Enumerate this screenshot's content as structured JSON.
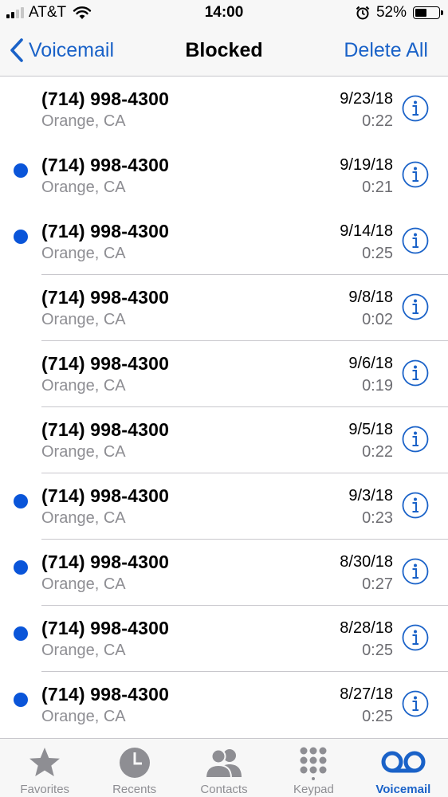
{
  "status": {
    "carrier": "AT&T",
    "time": "14:00",
    "battery_percent": "52%",
    "battery_level": 0.52,
    "icons": [
      "signal-icon",
      "wifi-icon",
      "alarm-icon",
      "battery-icon"
    ]
  },
  "nav": {
    "back_label": "Voicemail",
    "title": "Blocked",
    "action_label": "Delete All"
  },
  "colors": {
    "accent": "#1a62c8",
    "unread_dot": "#0a55d9",
    "secondary_text": "#8e8e93"
  },
  "voicemails": [
    {
      "number": "(714) 998-4300",
      "location": "Orange, CA",
      "date": "9/23/18",
      "duration": "0:22",
      "unread": false
    },
    {
      "number": "(714) 998-4300",
      "location": "Orange, CA",
      "date": "9/19/18",
      "duration": "0:21",
      "unread": true
    },
    {
      "number": "(714) 998-4300",
      "location": "Orange, CA",
      "date": "9/14/18",
      "duration": "0:25",
      "unread": true
    },
    {
      "number": "(714) 998-4300",
      "location": "Orange, CA",
      "date": "9/8/18",
      "duration": "0:02",
      "unread": false
    },
    {
      "number": "(714) 998-4300",
      "location": "Orange, CA",
      "date": "9/6/18",
      "duration": "0:19",
      "unread": false
    },
    {
      "number": "(714) 998-4300",
      "location": "Orange, CA",
      "date": "9/5/18",
      "duration": "0:22",
      "unread": false
    },
    {
      "number": "(714) 998-4300",
      "location": "Orange, CA",
      "date": "9/3/18",
      "duration": "0:23",
      "unread": true
    },
    {
      "number": "(714) 998-4300",
      "location": "Orange, CA",
      "date": "8/30/18",
      "duration": "0:27",
      "unread": true
    },
    {
      "number": "(714) 998-4300",
      "location": "Orange, CA",
      "date": "8/28/18",
      "duration": "0:25",
      "unread": true
    },
    {
      "number": "(714) 998-4300",
      "location": "Orange, CA",
      "date": "8/27/18",
      "duration": "0:25",
      "unread": true
    }
  ],
  "tabs": [
    {
      "label": "Favorites",
      "icon": "star-icon",
      "active": false
    },
    {
      "label": "Recents",
      "icon": "clock-icon",
      "active": false
    },
    {
      "label": "Contacts",
      "icon": "contacts-icon",
      "active": false
    },
    {
      "label": "Keypad",
      "icon": "keypad-icon",
      "active": false
    },
    {
      "label": "Voicemail",
      "icon": "voicemail-icon",
      "active": true
    }
  ]
}
